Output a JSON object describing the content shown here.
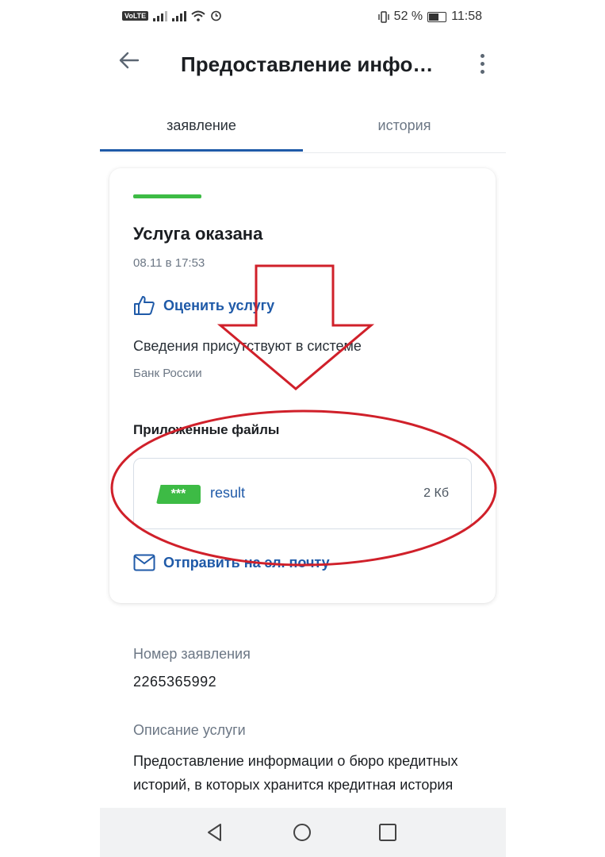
{
  "status_bar": {
    "volte": "VoLTE",
    "battery_percent": "52 %",
    "time": "11:58"
  },
  "header": {
    "title": "Предоставление информации о бюро кредитных историй, в которых хранится кредитная история",
    "back_icon": "arrow-left-icon",
    "menu_icon": "more-vertical-icon"
  },
  "tabs": [
    {
      "label": "заявление",
      "active": true
    },
    {
      "label": "история",
      "active": false
    }
  ],
  "card": {
    "status_title": "Услуга оказана",
    "status_color": "#3dbb45",
    "date": "08.11 в 17:53",
    "rate_label": "Оценить услугу",
    "info_text": "Сведения присутствуют в системе",
    "organization": "Банк России",
    "files_heading": "Приложенные файлы",
    "file": {
      "badge": "***",
      "name": "result",
      "size": "2 Кб"
    },
    "email_label": "Отправить на эл. почту"
  },
  "details": {
    "number_label": "Номер заявления",
    "number_value": "2265365992",
    "description_label": "Описание услуги",
    "description_value": "Предоставление информации о бюро кредитных историй, в которых хранится кредитная история"
  },
  "colors": {
    "accent": "#1f5aa8",
    "success": "#3dbb45",
    "annotation": "#d0202a"
  }
}
